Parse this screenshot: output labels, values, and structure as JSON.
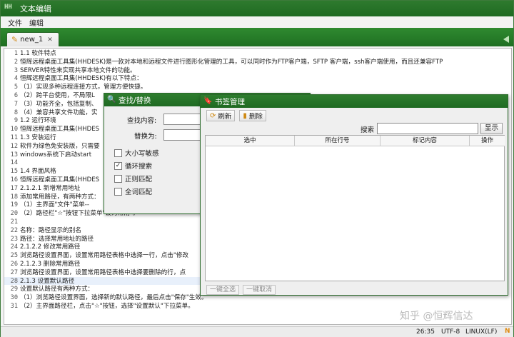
{
  "window": {
    "title": "文本编辑"
  },
  "menu": {
    "items": [
      "文件",
      "编辑"
    ]
  },
  "tabs": [
    {
      "label": "new_1"
    }
  ],
  "editor": {
    "lines": [
      "1.1 软件特点",
      "恒辉远程桌面工具集(HHDESK)是一款对本地和远程文件进行图形化管理的工具，可以同时作为FTP客户端，SFTP 客户端，ssh客户端使用，而且还兼容FTP",
      "SERVER特性来实现共享本地文件的功能。",
      "恒辉远程桌面工具集(HHDESK)有以下特点：",
      "（1）实现多种远程连接方式，管理方便快捷。",
      "（2）跨平台使用，不局限L",
      "（3）功能齐全，包括复制、",
      "（4）兼容共享文件功能，实",
      "1.2 运行环境",
      "恒辉远程桌面工具集(HHDES",
      "1.3 安装运行",
      "软件为绿色免安装版，只需要",
      "windows系统下启动start",
      "",
      "1.4 界面风格",
      "恒辉远程桌面工具集(HHDES",
      "2.1.2.1 新增常用地址",
      "添加常用路径，有两种方式：",
      "（1）主界面\"文件\"菜单--",
      "（2）路径栏\"☆\"按钮下拉菜单\"设为常用\"。",
      "",
      "名称：路径显示的别名",
      "路径：选择常用地址的路径",
      "2.1.2.2 修改常用路径",
      "浏览路径设置界面，设置常用路径表格中选择一行，点击\"修改",
      "2.1.2.3 删除常用路径",
      "浏览路径设置界面，设置常用路径表格中选择要删除的行，点",
      "2.1.3 设置默认路径",
      "设置默认路径有两种方式：",
      "（1）浏览路径设置界面，选择新的默认路径，最后点击\"保存\"生效。",
      "（2）主界面路径栏，点击\"☆\"按钮，选择\"设置默认\"下拉菜单。"
    ]
  },
  "status": {
    "position": "26:35",
    "encoding": "UTF-8",
    "eol": "LINUX(LF)",
    "mode": "N"
  },
  "watermark": "知乎 @恒辉信达",
  "find_dialog": {
    "title": "查找/替换",
    "find_label": "查找内容:",
    "replace_label": "替换为:",
    "options": [
      {
        "label": "大小写敏感",
        "checked": false
      },
      {
        "label": "循环搜索",
        "checked": true
      },
      {
        "label": "正则匹配",
        "checked": false
      },
      {
        "label": "全词匹配",
        "checked": false
      }
    ]
  },
  "bookmark_dialog": {
    "title": "书签管理",
    "refresh_label": "刷新",
    "delete_label": "删除",
    "search_label": "搜索",
    "search_button": "显示",
    "columns": [
      "选中",
      "所在行号",
      "标记内容",
      "操作"
    ],
    "select_all": "一键全选",
    "cancel_all": "一键取消"
  },
  "colors": {
    "titlebar": "#2e7a2e",
    "tabstrip": "#2f8a30",
    "accent_orange": "#e08a10"
  }
}
